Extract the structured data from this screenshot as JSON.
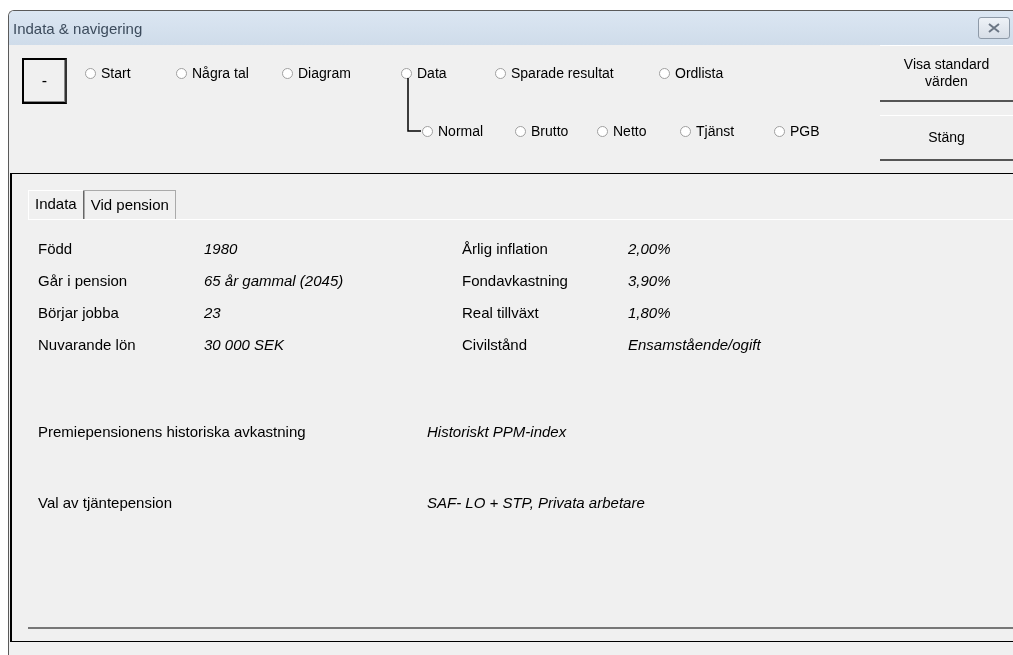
{
  "window": {
    "title": "Indata & navigering"
  },
  "collapse_button": "-",
  "nav_options": [
    {
      "label": "Start",
      "selected": false
    },
    {
      "label": "Några tal",
      "selected": false
    },
    {
      "label": "Diagram",
      "selected": false
    },
    {
      "label": "Data",
      "selected": false
    },
    {
      "label": "Sparade resultat",
      "selected": false
    },
    {
      "label": "Ordlista",
      "selected": false
    }
  ],
  "data_options": [
    {
      "label": "Normal",
      "selected": false
    },
    {
      "label": "Brutto",
      "selected": false
    },
    {
      "label": "Netto",
      "selected": false
    },
    {
      "label": "Tjänst",
      "selected": false
    },
    {
      "label": "PGB",
      "selected": false
    }
  ],
  "buttons": [
    "Visa standard värden",
    "Stäng"
  ],
  "tabs": [
    {
      "label": "Indata",
      "selected": true
    },
    {
      "label": "Vid pension",
      "selected": false
    }
  ],
  "fields_left": [
    {
      "label": "Född",
      "value": "1980"
    },
    {
      "label": "Går i pension",
      "value": "65 år gammal (2045)"
    },
    {
      "label": "Börjar jobba",
      "value": "23"
    },
    {
      "label": "Nuvarande lön",
      "value": "30 000 SEK"
    }
  ],
  "fields_right": [
    {
      "label": "Årlig inflation",
      "value": "2,00%"
    },
    {
      "label": "Fondavkastning",
      "value": "3,90%"
    },
    {
      "label": "Real tillväxt",
      "value": "1,80%"
    },
    {
      "label": "Civilstånd",
      "value": "Ensamstående/ogift"
    }
  ],
  "choices": [
    {
      "label": "Premiepensionens historiska avkastning",
      "value": "Historiskt PPM-index"
    },
    {
      "label": "Val av tjäntepension",
      "value": "SAF- LO + STP, Privata arbetare"
    }
  ]
}
